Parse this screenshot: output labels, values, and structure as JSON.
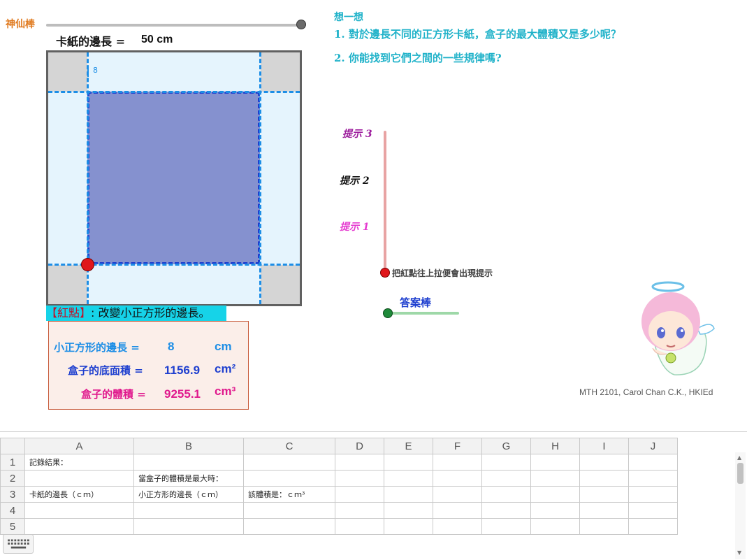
{
  "wand": {
    "label": "神仙棒"
  },
  "card": {
    "side_label": "卡紙的邊長 =",
    "side_value": "50 cm",
    "small_side_marker": "8"
  },
  "red_dot": {
    "bracket": "【紅點】",
    "caption": ": 改變小正方形的邊長。"
  },
  "results": {
    "small_side_label": "小正方形的邊長 =",
    "small_side_value": "8",
    "small_side_unit": "cm",
    "base_area_label": "盒子的底面積 =",
    "base_area_value": "1156.9",
    "base_area_unit": "cm²",
    "volume_label": "盒子的體積 =",
    "volume_value": "9255.1",
    "volume_unit": "cm³"
  },
  "think": {
    "title": "想一想",
    "q1": "1. 對於邊長不同的正方形卡紙，盒子的最大體積又是多少呢？",
    "q2": "2. 你能找到它們之間的一些規律嗎?"
  },
  "hints": {
    "hint3": "提示 3",
    "hint2": "提示 2",
    "hint1": "提示 1",
    "caption": "把紅點往上拉便會出現提示"
  },
  "answer": {
    "label": "答案棒"
  },
  "credit": "MTH 2101, Carol Chan C.K., HKIEd",
  "spreadsheet": {
    "columns": [
      "A",
      "B",
      "C",
      "D",
      "E",
      "F",
      "G",
      "H",
      "I",
      "J"
    ],
    "rows": [
      {
        "num": "1",
        "cells": [
          "記錄結果：",
          "",
          "",
          "",
          "",
          "",
          "",
          "",
          "",
          ""
        ]
      },
      {
        "num": "2",
        "cells": [
          "",
          "當盒子的體積是最大時：",
          "",
          "",
          "",
          "",
          "",
          "",
          "",
          ""
        ]
      },
      {
        "num": "3",
        "cells": [
          "卡紙的邊長（ｃｍ）",
          "小正方形的邊長（ｃｍ）",
          "該體積是：ｃｍ³",
          "",
          "",
          "",
          "",
          "",
          "",
          ""
        ]
      },
      {
        "num": "4",
        "cells": [
          "",
          "",
          "",
          "",
          "",
          "",
          "",
          "",
          "",
          ""
        ]
      },
      {
        "num": "5",
        "cells": [
          "",
          "",
          "",
          "",
          "",
          "",
          "",
          "",
          "",
          ""
        ]
      }
    ]
  },
  "colors": {
    "accent_cyan": "#1fb2c9",
    "wand_orange": "#e07a1f",
    "base_fill": "#8591cf"
  }
}
